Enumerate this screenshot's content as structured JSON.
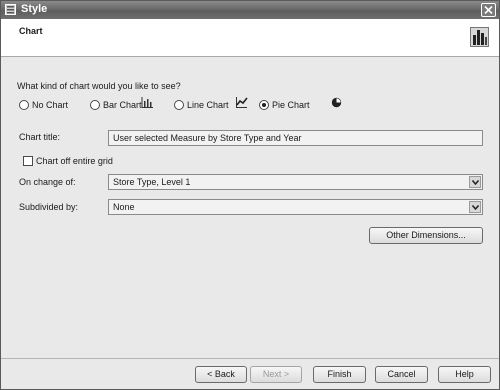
{
  "window": {
    "title": "Style"
  },
  "header": {
    "heading": "Chart"
  },
  "chart_type": {
    "question": "What kind of chart would you like to see?",
    "options": [
      {
        "label": "No Chart",
        "selected": false
      },
      {
        "label": "Bar Chart",
        "selected": false
      },
      {
        "label": "Line Chart",
        "selected": false
      },
      {
        "label": "Pie Chart",
        "selected": true
      }
    ]
  },
  "chart_title": {
    "label": "Chart title:",
    "value": "User selected Measure by Store Type and Year"
  },
  "chart_off_grid": {
    "label": "Chart off entire grid",
    "checked": false
  },
  "on_change_of": {
    "label": "On change of:",
    "value": "Store Type, Level 1"
  },
  "subdivided_by": {
    "label": "Subdivided by:",
    "value": "None"
  },
  "other_dimensions": {
    "label": "Other Dimensions..."
  },
  "footer": {
    "back": "< Back",
    "next": "Next >",
    "finish": "Finish",
    "cancel": "Cancel",
    "help": "Help"
  }
}
